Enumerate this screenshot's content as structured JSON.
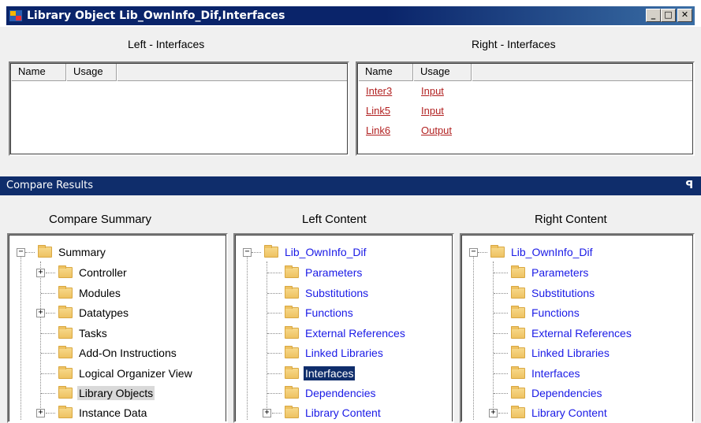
{
  "window": {
    "title": "Library Object Lib_OwnInfo_Dif,Interfaces"
  },
  "left_interfaces": {
    "title": "Left - Interfaces",
    "columns": [
      "Name",
      "Usage"
    ],
    "rows": []
  },
  "right_interfaces": {
    "title": "Right - Interfaces",
    "columns": [
      "Name",
      "Usage"
    ],
    "rows": [
      {
        "name": "Inter3",
        "usage": "Input"
      },
      {
        "name": "Link5",
        "usage": "Input"
      },
      {
        "name": "Link6",
        "usage": "Output"
      }
    ]
  },
  "compare_results": {
    "title": "Compare Results",
    "pin_glyph": "ꟼ"
  },
  "compare_summary": {
    "title": "Compare Summary",
    "root": "Summary",
    "items": [
      "Controller",
      "Modules",
      "Datatypes",
      "Tasks",
      "Add-On Instructions",
      "Logical Organizer View",
      "Library Objects",
      "Instance Data"
    ],
    "selected": "Library Objects"
  },
  "left_content": {
    "title": "Left Content",
    "root": "Lib_OwnInfo_Dif",
    "items": [
      "Parameters",
      "Substitutions",
      "Functions",
      "External References",
      "Linked Libraries",
      "Interfaces",
      "Dependencies",
      "Library Content"
    ],
    "selected": "Interfaces"
  },
  "right_content": {
    "title": "Right Content",
    "root": "Lib_OwnInfo_Dif",
    "items": [
      "Parameters",
      "Substitutions",
      "Functions",
      "External References",
      "Linked Libraries",
      "Interfaces",
      "Dependencies",
      "Library Content"
    ]
  },
  "colors": {
    "title_bar": "#0a246a",
    "results_bar": "#0f2d6b",
    "diff_link": "#b22222",
    "tree_text_blue": "#1a1ae6"
  }
}
